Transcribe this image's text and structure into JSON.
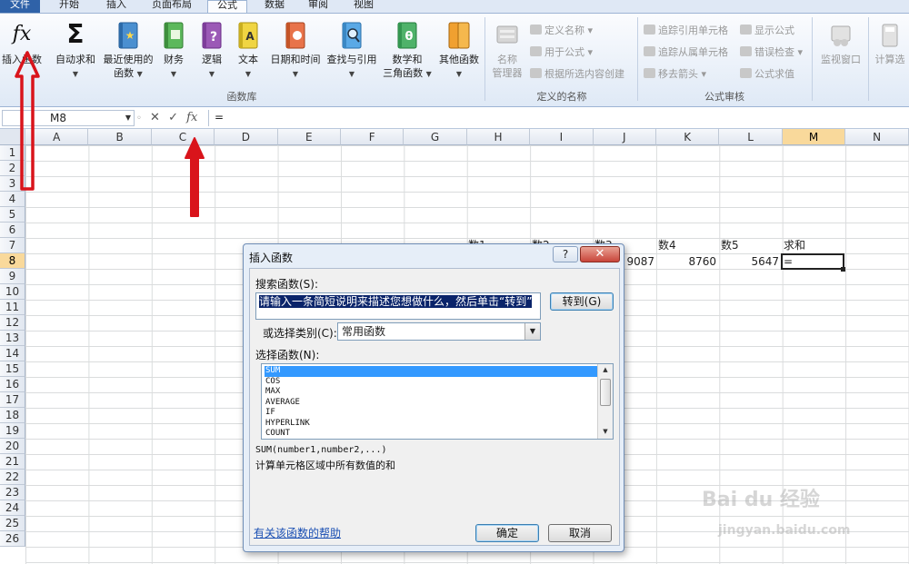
{
  "ribbon_tabs": [
    "文件",
    "开始",
    "插入",
    "页面布局",
    "公式",
    "数据",
    "审阅",
    "视图"
  ],
  "active_tab": "公式",
  "ribbon": {
    "insert_function": "插入函数",
    "autosum": "自动求和",
    "recent_line1": "最近使用的",
    "recent_line2": "函数",
    "finance": "财务",
    "logic": "逻辑",
    "text": "文本",
    "datetime": "日期和时间",
    "lookup": "查找与引用",
    "math_line1": "数学和",
    "math_line2": "三角函数",
    "other": "其他函数",
    "group_function_library": "函数库",
    "name_mgr_line1": "名称",
    "name_mgr_line2": "管理器",
    "define_name": "定义名称",
    "use_in_formula": "用于公式",
    "create_from_selection": "根据所选内容创建",
    "group_defined_names": "定义的名称",
    "trace_precedents": "追踪引用单元格",
    "trace_dependents": "追踪从属单元格",
    "remove_arrows": "移去箭头",
    "show_formulas": "显示公式",
    "error_check": "错误检查",
    "evaluate_formula": "公式求值",
    "group_formula_auditing": "公式审核",
    "watch_window": "监视窗口",
    "calc_options": "计算选"
  },
  "formula_bar": {
    "name_box": "M8",
    "content": "="
  },
  "columns": [
    "A",
    "B",
    "C",
    "D",
    "E",
    "F",
    "G",
    "H",
    "I",
    "J",
    "K",
    "L",
    "M",
    "N"
  ],
  "rows": [
    "1",
    "2",
    "3",
    "4",
    "5",
    "6",
    "7",
    "8",
    "9",
    "10",
    "11",
    "12",
    "13",
    "14",
    "15",
    "16",
    "17",
    "18",
    "19",
    "20",
    "21",
    "22",
    "23",
    "24",
    "25",
    "26"
  ],
  "cells": {
    "h7": "数1",
    "i7": "数2",
    "j7": "数3",
    "k7": "数4",
    "l7": "数5",
    "m7": "求和",
    "j8": "9087",
    "k8": "8760",
    "l8": "5647",
    "m8": "="
  },
  "dialog": {
    "title": "插入函数",
    "help": "?",
    "close": "✕",
    "search_label": "搜索函数(S):",
    "search_value": "请输入一条简短说明来描述您想做什么，然后单击“转到”",
    "go_button": "转到(G)",
    "category_label": "或选择类别(C):",
    "category_value": "常用函数",
    "select_label": "选择函数(N):",
    "functions": [
      "SUM",
      "COS",
      "MAX",
      "AVERAGE",
      "IF",
      "HYPERLINK",
      "COUNT"
    ],
    "selected_function": "SUM",
    "syntax": "SUM(number1,number2,...)",
    "description": "计算单元格区域中所有数值的和",
    "help_link": "有关该函数的帮助",
    "ok": "确定",
    "cancel": "取消"
  },
  "watermark": {
    "brand": "Bai du 经验",
    "url": "jingyan.baidu.com"
  },
  "colors": {
    "accent": "#2f62a8",
    "selected_header": "#f9d99b",
    "arrow": "#d9141b",
    "list_selection": "#3399ff"
  }
}
